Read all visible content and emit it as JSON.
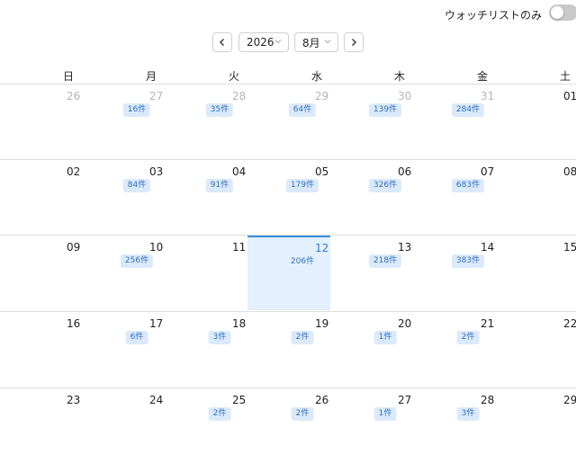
{
  "header": {
    "watchlist_label": "ウォッチリストのみ",
    "watchlist_toggle_on": false
  },
  "nav": {
    "year": "2026",
    "month": "8月"
  },
  "weekdays": [
    "日",
    "月",
    "火",
    "水",
    "木",
    "金",
    "土"
  ],
  "colors": {
    "accent": "#3b8de0",
    "selected_bg": "#e3f0fd",
    "badge_bg": "#dbeafb",
    "badge_text": "#2e6fc2"
  },
  "weeks": [
    [
      {
        "day": "26",
        "other": true,
        "count": ""
      },
      {
        "day": "27",
        "other": true,
        "count": "16件"
      },
      {
        "day": "28",
        "other": true,
        "count": "35件"
      },
      {
        "day": "29",
        "other": true,
        "count": "64件"
      },
      {
        "day": "30",
        "other": true,
        "count": "139件"
      },
      {
        "day": "31",
        "other": true,
        "count": "284件"
      },
      {
        "day": "01",
        "other": false,
        "count": ""
      }
    ],
    [
      {
        "day": "02",
        "count": ""
      },
      {
        "day": "03",
        "count": "84件"
      },
      {
        "day": "04",
        "count": "91件"
      },
      {
        "day": "05",
        "count": "179件"
      },
      {
        "day": "06",
        "count": "326件"
      },
      {
        "day": "07",
        "count": "683件"
      },
      {
        "day": "08",
        "count": ""
      }
    ],
    [
      {
        "day": "09",
        "count": ""
      },
      {
        "day": "10",
        "count": "256件"
      },
      {
        "day": "11",
        "count": ""
      },
      {
        "day": "12",
        "count": "206件",
        "selected": true
      },
      {
        "day": "13",
        "count": "218件"
      },
      {
        "day": "14",
        "count": "383件"
      },
      {
        "day": "15",
        "count": ""
      }
    ],
    [
      {
        "day": "16",
        "count": ""
      },
      {
        "day": "17",
        "count": "6件"
      },
      {
        "day": "18",
        "count": "3件"
      },
      {
        "day": "19",
        "count": "2件"
      },
      {
        "day": "20",
        "count": "1件"
      },
      {
        "day": "21",
        "count": "2件"
      },
      {
        "day": "22",
        "count": ""
      }
    ],
    [
      {
        "day": "23",
        "count": ""
      },
      {
        "day": "24",
        "count": ""
      },
      {
        "day": "25",
        "count": "2件"
      },
      {
        "day": "26",
        "count": "2件"
      },
      {
        "day": "27",
        "count": "1件"
      },
      {
        "day": "28",
        "count": "3件"
      },
      {
        "day": "29",
        "count": ""
      }
    ]
  ]
}
